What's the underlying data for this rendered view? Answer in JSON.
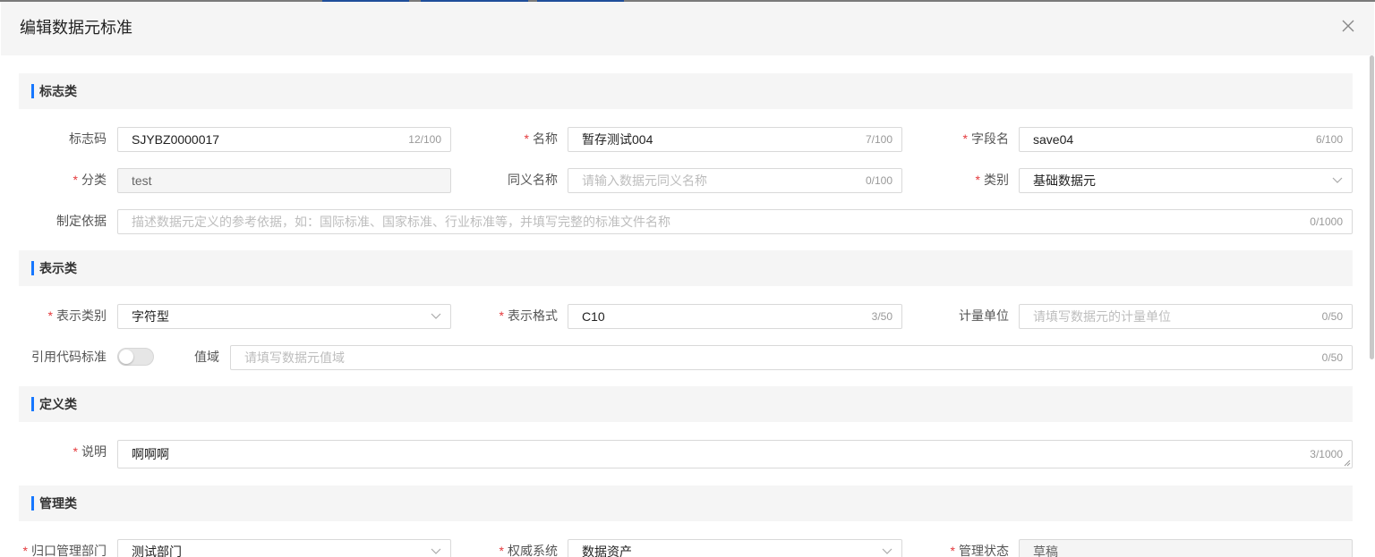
{
  "dialog": {
    "title": "编辑数据元标准"
  },
  "sections": {
    "identify": "标志类",
    "represent": "表示类",
    "define": "定义类",
    "manage": "管理类"
  },
  "identify": {
    "code": {
      "label": "标志码",
      "value": "SJYBZ0000017",
      "count": "12/100"
    },
    "name": {
      "label": "名称",
      "value": "暂存测试004",
      "count": "7/100"
    },
    "field_name": {
      "label": "字段名",
      "value": "save04",
      "count": "6/100"
    },
    "category": {
      "label": "分类",
      "value": "test"
    },
    "synonym": {
      "label": "同义名称",
      "placeholder": "请输入数据元同义名称",
      "count": "0/100"
    },
    "type": {
      "label": "类别",
      "value": "基础数据元"
    },
    "basis": {
      "label": "制定依据",
      "placeholder": "描述数据元定义的参考依据，如：国际标准、国家标准、行业标准等，并填写完整的标准文件名称",
      "count": "0/1000"
    }
  },
  "represent": {
    "rep_type": {
      "label": "表示类别",
      "value": "字符型"
    },
    "rep_format": {
      "label": "表示格式",
      "value": "C10",
      "count": "3/50"
    },
    "unit": {
      "label": "计量单位",
      "placeholder": "请填写数据元的计量单位",
      "count": "0/50"
    },
    "ref_code": {
      "label": "引用代码标准",
      "enabled": false
    },
    "value_domain": {
      "label": "值域",
      "placeholder": "请填写数据元值域",
      "count": "0/50"
    }
  },
  "define": {
    "description": {
      "label": "说明",
      "value": "啊啊啊",
      "count": "3/1000"
    }
  },
  "manage": {
    "dept": {
      "label": "归口管理部门",
      "value": "测试部门"
    },
    "authority": {
      "label": "权威系统",
      "value": "数据资产"
    },
    "status": {
      "label": "管理状态",
      "value": "草稿"
    }
  },
  "colors": {
    "accent": "#1677ff",
    "required": "#e4393c",
    "section_bg": "#f5f5f5"
  }
}
